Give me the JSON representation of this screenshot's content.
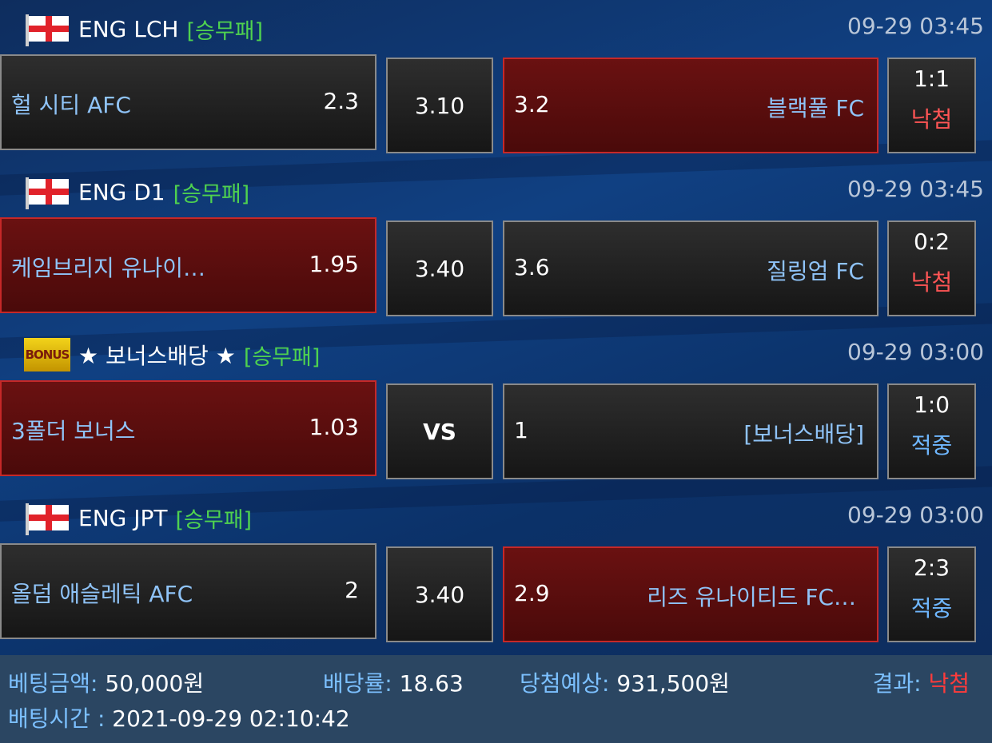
{
  "matches": [
    {
      "league": "ENG LCH",
      "league_icon": "england-flag-icon",
      "market": "[승무패]",
      "datetime": "09-29 03:45",
      "home_team": "헐 시티 AFC",
      "home_odds": "2.3",
      "draw_odds": "3.10",
      "away_odds": "3.2",
      "away_team": "블랙풀 FC",
      "selected": "away",
      "score": "1:1",
      "outcome": "낙첨",
      "outcome_color": "#ff5555"
    },
    {
      "league": "ENG D1",
      "league_icon": "england-flag-icon",
      "market": "[승무패]",
      "datetime": "09-29 03:45",
      "home_team": "케임브리지 유나이…",
      "home_odds": "1.95",
      "draw_odds": "3.40",
      "away_odds": "3.6",
      "away_team": "질링엄 FC",
      "selected": "home",
      "score": "0:2",
      "outcome": "낙첨",
      "outcome_color": "#ff5555"
    },
    {
      "league": "★ 보너스배당 ★",
      "league_icon": "bonus-badge-icon",
      "league_icon_text": "BONUS",
      "market": "[승무패]",
      "datetime": "09-29 03:00",
      "home_team": "3폴더 보너스",
      "home_odds": "1.03",
      "draw_odds": "VS",
      "away_odds": "1",
      "away_team": "[보너스배당]",
      "selected": "home",
      "score": "1:0",
      "outcome": "적중",
      "outcome_color": "#6fb7ff"
    },
    {
      "league": "ENG JPT",
      "league_icon": "england-flag-icon",
      "market": "[승무패]",
      "datetime": "09-29 03:00",
      "home_team": "올덤 애슬레틱 AFC",
      "home_odds": "2",
      "draw_odds": "3.40",
      "away_odds": "2.9",
      "away_team": "리즈 유나이티드 FC…",
      "selected": "away",
      "score": "2:3",
      "outcome": "적중",
      "outcome_color": "#6fb7ff"
    }
  ],
  "footer": {
    "bet_amount_label": "베팅금액:",
    "bet_amount": "50,000원",
    "odds_label": "배당률:",
    "odds": "18.63",
    "expected_label": "당첨예상:",
    "expected": "931,500원",
    "result_label": "결과:",
    "result": "낙첨",
    "result_color": "#ff3b3b",
    "bet_time_label": "배팅시간 :",
    "bet_time": "2021-09-29 02:10:42"
  },
  "colors": {
    "background": "#0c3470",
    "selected_box": "#5a0e0e",
    "market_green": "#4fd24f",
    "team_blue": "#8fc3f7",
    "footer_bg": "#2b4662"
  }
}
